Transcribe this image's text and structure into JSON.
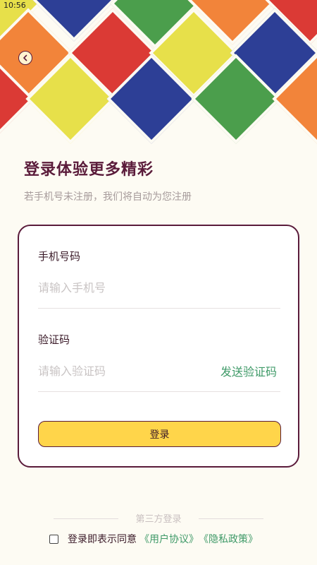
{
  "status_bar": {
    "time": "10:56"
  },
  "hero": {
    "palette": {
      "yellow": "#e7e04a",
      "red": "#db3a35",
      "blue": "#2d3f96",
      "green": "#4b9e4c",
      "orange": "#f2843a"
    }
  },
  "header": {
    "back_icon": "chevron-left-icon",
    "title": "登录体验更多精彩",
    "subtitle": "若手机号未注册，我们将自动为您注册"
  },
  "form": {
    "phone_label": "手机号码",
    "phone_placeholder": "请输入手机号",
    "phone_value": "",
    "code_label": "验证码",
    "code_placeholder": "请输入验证码",
    "code_value": "",
    "send_code_label": "发送验证码",
    "login_label": "登录"
  },
  "third_party": {
    "label": "第三方登录"
  },
  "agreement": {
    "checked": false,
    "text": "登录即表示同意",
    "user_agreement": "《用户协议》",
    "privacy_policy": "《隐私政策》"
  },
  "colors": {
    "background": "#fdfbf3",
    "primary_dark": "#5a1b3a",
    "accent_yellow": "#ffd54a",
    "link_green": "#3f9a68"
  }
}
